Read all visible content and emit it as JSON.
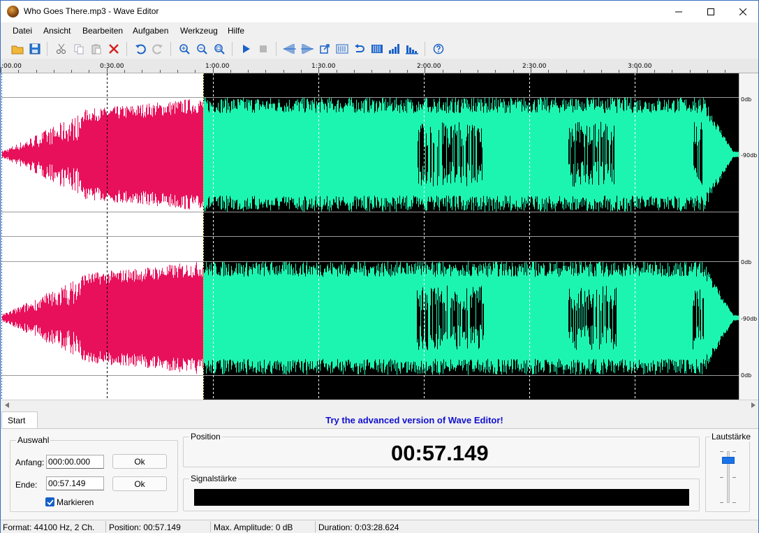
{
  "window": {
    "title": "Who Goes There.mp3 - Wave Editor"
  },
  "menu": [
    "Datei",
    "Ansicht",
    "Bearbeiten",
    "Aufgaben",
    "Werkzeug",
    "Hilfe"
  ],
  "toolbar": {
    "icons": [
      "open-folder-icon",
      "save-icon",
      "cut-icon",
      "copy-icon",
      "paste-icon",
      "delete-icon",
      "undo-icon",
      "redo-icon",
      "zoom-in-icon",
      "zoom-out-icon",
      "zoom-fit-icon",
      "play-icon",
      "stop-icon",
      "fade-in-icon",
      "fade-out-icon",
      "normalize-icon",
      "silence-icon",
      "reverse-icon",
      "amplify-icon",
      "level-icon",
      "equalizer-icon",
      "help-icon"
    ]
  },
  "ruler": {
    "ticks": [
      ":00.00",
      "0:30.00",
      "1:00.00",
      "1:30.00",
      "2:00.00",
      "2:30.00",
      "3:00.00"
    ]
  },
  "channels": {
    "db_labels": [
      "0db",
      "-90db",
      "0db",
      "0db",
      "-90db",
      "0db"
    ]
  },
  "colors": {
    "selected_wave": "#e8105a",
    "unselected_wave": "#1cf5b0",
    "wave_background": "#000000",
    "selection_background": "#ffffff",
    "accent": "#1560c8",
    "promo": "#1010d0"
  },
  "bottom": {
    "tab_label": "Start",
    "promo_text": "Try the advanced version of Wave Editor!",
    "selection": {
      "title": "Auswahl",
      "start_label": "Anfang:",
      "start_value": "000:00.000",
      "end_label": "Ende:",
      "end_value": "00:57.149",
      "ok_label": "Ok",
      "mark_label": "Markieren",
      "mark_checked": true
    },
    "position": {
      "title": "Position",
      "value": "00:57.149"
    },
    "signal": {
      "title": "Signalstärke"
    },
    "volume": {
      "title": "Lautstärke",
      "level": 0.88
    }
  },
  "status": {
    "format": "Format: 44100 Hz, 2 Ch.",
    "position": "Position: 00:57.149",
    "max_amplitude": "Max. Amplitude: 0 dB",
    "duration": "Duration: 0:03:28.624"
  }
}
